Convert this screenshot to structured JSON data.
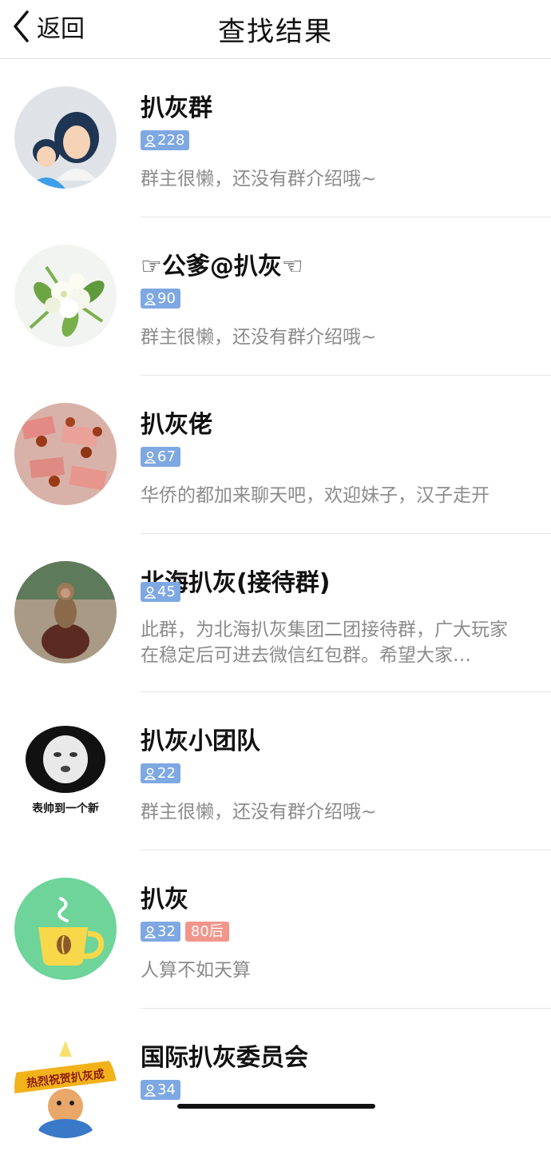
{
  "nav": {
    "back_label": "返回",
    "title": "查找结果"
  },
  "results": [
    {
      "name": "扒灰群",
      "count": "228",
      "tag": "",
      "desc": "群主很懒，还没有群介绍哦~"
    },
    {
      "name": "☞公爹@扒灰☜",
      "count": "90",
      "tag": "",
      "desc": "群主很懒，还没有群介绍哦~"
    },
    {
      "name": "扒灰佬",
      "count": "67",
      "tag": "",
      "desc": "华侨的都加来聊天吧，欢迎妹子，汉子走开"
    },
    {
      "name": "北海扒灰(接待群)",
      "count": "45",
      "tag": "",
      "desc": "此群，为北海扒灰集团二团接待群，广大玩家在稳定后可进去微信红包群。希望大家…"
    },
    {
      "name": "扒灰小团队",
      "count": "22",
      "tag": "",
      "desc": "群主很懒，还没有群介绍哦~"
    },
    {
      "name": "扒灰",
      "count": "32",
      "tag": "80后",
      "desc": "人算不如天算"
    },
    {
      "name": "国际扒灰委员会",
      "count": "34",
      "tag": "",
      "desc": ""
    }
  ],
  "avatar_images": {
    "meme_caption": "表帅到一个新",
    "sign_text": "热烈祝贺扒灰成"
  },
  "colors": {
    "badge_blue": "#7ea8e2",
    "badge_red": "#f2958b",
    "desc_gray": "#8b8b8b"
  }
}
